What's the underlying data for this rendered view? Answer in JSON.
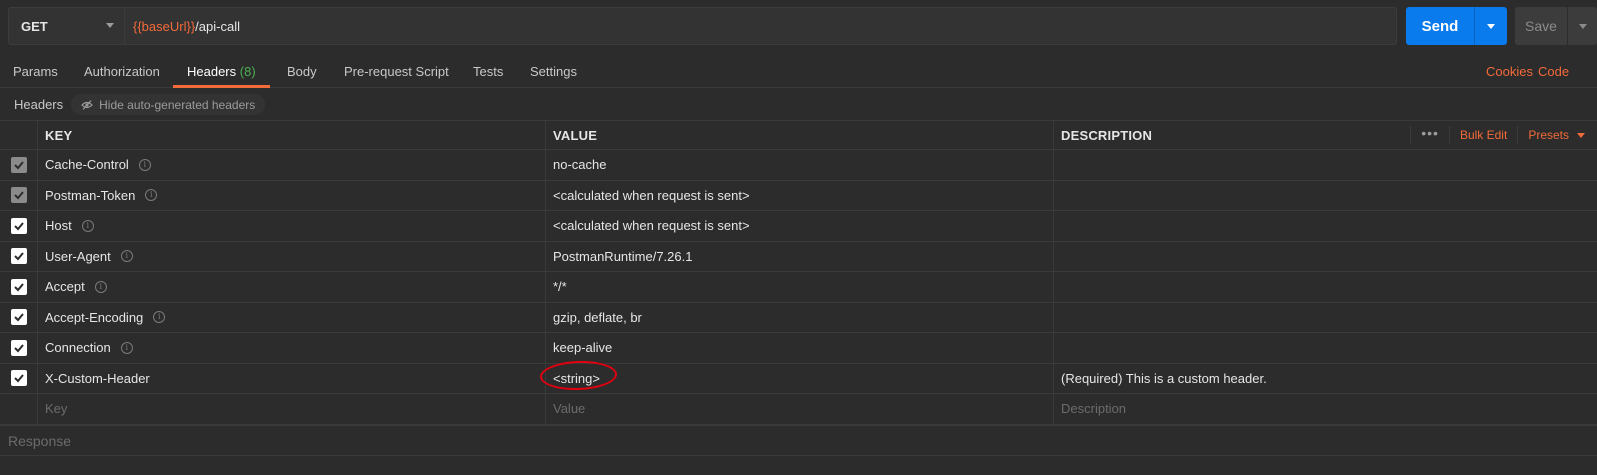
{
  "request": {
    "method": "GET",
    "url_variable": "{{baseUrl}}",
    "url_path": "/api-call"
  },
  "buttons": {
    "send": "Send",
    "save": "Save"
  },
  "tabs": [
    {
      "label": "Params"
    },
    {
      "label": "Authorization"
    },
    {
      "label": "Headers",
      "count": "(8)"
    },
    {
      "label": "Body"
    },
    {
      "label": "Pre-request Script"
    },
    {
      "label": "Tests"
    },
    {
      "label": "Settings"
    }
  ],
  "right_links": {
    "cookies": "Cookies",
    "code": "Code"
  },
  "headers_section": {
    "title": "Headers",
    "hide_auto": "Hide auto-generated headers"
  },
  "table": {
    "columns": {
      "key": "KEY",
      "value": "VALUE",
      "description": "DESCRIPTION"
    },
    "actions": {
      "more": "•••",
      "bulk_edit": "Bulk Edit",
      "presets": "Presets"
    },
    "rows": [
      {
        "key": "Cache-Control",
        "value": "no-cache",
        "description": "",
        "checked": "disabled"
      },
      {
        "key": "Postman-Token",
        "value": "<calculated when request is sent>",
        "description": "",
        "checked": "disabled"
      },
      {
        "key": "Host",
        "value": "<calculated when request is sent>",
        "description": "",
        "checked": "on"
      },
      {
        "key": "User-Agent",
        "value": "PostmanRuntime/7.26.1",
        "description": "",
        "checked": "on"
      },
      {
        "key": "Accept",
        "value": "*/*",
        "description": "",
        "checked": "on"
      },
      {
        "key": "Accept-Encoding",
        "value": "gzip, deflate, br",
        "description": "",
        "checked": "on"
      },
      {
        "key": "Connection",
        "value": "keep-alive",
        "description": "",
        "checked": "on"
      },
      {
        "key": "X-Custom-Header",
        "value": "<string>",
        "description": "(Required) This is a custom header.",
        "checked": "on"
      }
    ],
    "placeholders": {
      "key": "Key",
      "value": "Value",
      "description": "Description"
    }
  },
  "response": {
    "label": "Response"
  },
  "colors": {
    "accent": "#f26b3a",
    "send": "#097bed",
    "highlight": "#e0000f",
    "count": "#4caf50"
  }
}
